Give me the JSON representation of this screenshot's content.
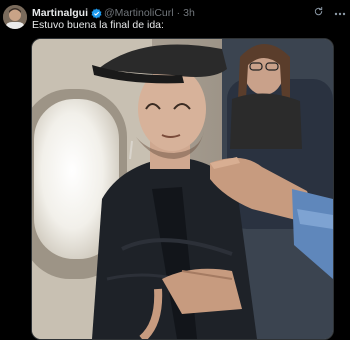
{
  "tweet": {
    "display_name": "Martinalgui",
    "handle": "@MartinoliCurl",
    "separator": "·",
    "time": "3h",
    "text": "Estuvo buena la final de ida:",
    "verified_color": "#1d9bf0"
  },
  "icons": [
    "avatar",
    "verified-badge-icon",
    "refresh-icon",
    "more-icon"
  ],
  "media": {
    "kind": "photo"
  }
}
